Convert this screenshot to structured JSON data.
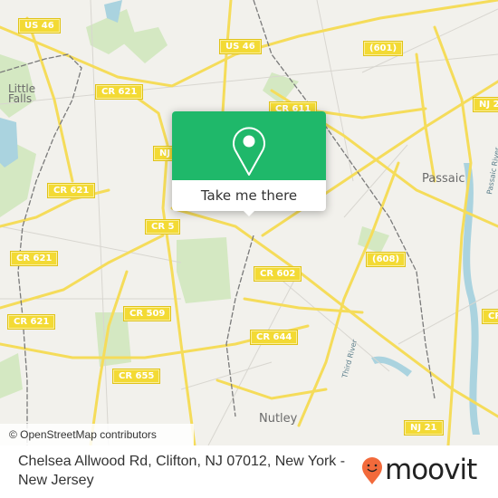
{
  "map": {
    "popup": {
      "button_label": "Take me there",
      "icon": "map-pin-icon",
      "color": "#1fb86a"
    },
    "road_labels": [
      {
        "id": "us46-west",
        "text": "US 46"
      },
      {
        "id": "us46-east",
        "text": "US 46"
      },
      {
        "id": "cr601",
        "text": "(601)"
      },
      {
        "id": "cr621-north",
        "text": "CR 621"
      },
      {
        "id": "cr611",
        "text": "CR 611"
      },
      {
        "id": "nj-west",
        "text": "NJ"
      },
      {
        "id": "nj21-north",
        "text": "NJ 2"
      },
      {
        "id": "cr621-a",
        "text": "CR 621"
      },
      {
        "id": "cr621-b",
        "text": "CR 621"
      },
      {
        "id": "cr621-c",
        "text": "CR 621"
      },
      {
        "id": "cr5",
        "text": "CR 5"
      },
      {
        "id": "cr608",
        "text": "(608)"
      },
      {
        "id": "cr602",
        "text": "CR 602"
      },
      {
        "id": "cr509",
        "text": "CR 509"
      },
      {
        "id": "cr644",
        "text": "CR 644"
      },
      {
        "id": "cr655",
        "text": "CR 655"
      },
      {
        "id": "cr-east",
        "text": "CR"
      },
      {
        "id": "nj21-south",
        "text": "NJ 21"
      }
    ],
    "place_labels": [
      {
        "id": "little-falls",
        "text": "Little\nFalls"
      },
      {
        "id": "passaic",
        "text": "Passaic"
      },
      {
        "id": "nutley",
        "text": "Nutley"
      }
    ],
    "water_labels": [
      {
        "id": "passaic-river",
        "text": "Passaic River"
      },
      {
        "id": "third-river",
        "text": "Third River"
      }
    ],
    "attribution": "© OpenStreetMap contributors"
  },
  "footer": {
    "address": "Chelsea Allwood Rd, Clifton, NJ 07012, New York - New Jersey",
    "brand": "moovit",
    "brand_color": "#f26a3b"
  }
}
